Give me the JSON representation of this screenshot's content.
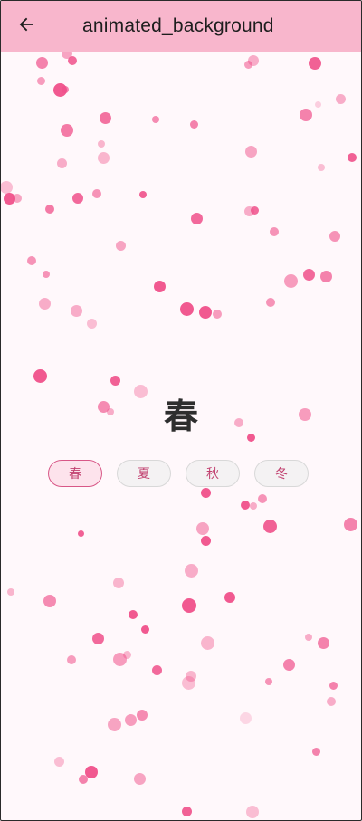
{
  "appbar": {
    "title": "animated_background",
    "back_icon": "arrow-back-icon",
    "background": "#f8b6cc"
  },
  "season": {
    "current": "春"
  },
  "chips": [
    {
      "label": "春",
      "selected": true
    },
    {
      "label": "夏",
      "selected": false
    },
    {
      "label": "秋",
      "selected": false
    },
    {
      "label": "冬",
      "selected": false
    }
  ],
  "colors": {
    "accent": "#e0447a",
    "chip_selected_bg": "#fde3ec",
    "chip_bg": "#f4f2f3",
    "page_bg": "#fff8fb",
    "bubble_pink": "#f0508a"
  }
}
